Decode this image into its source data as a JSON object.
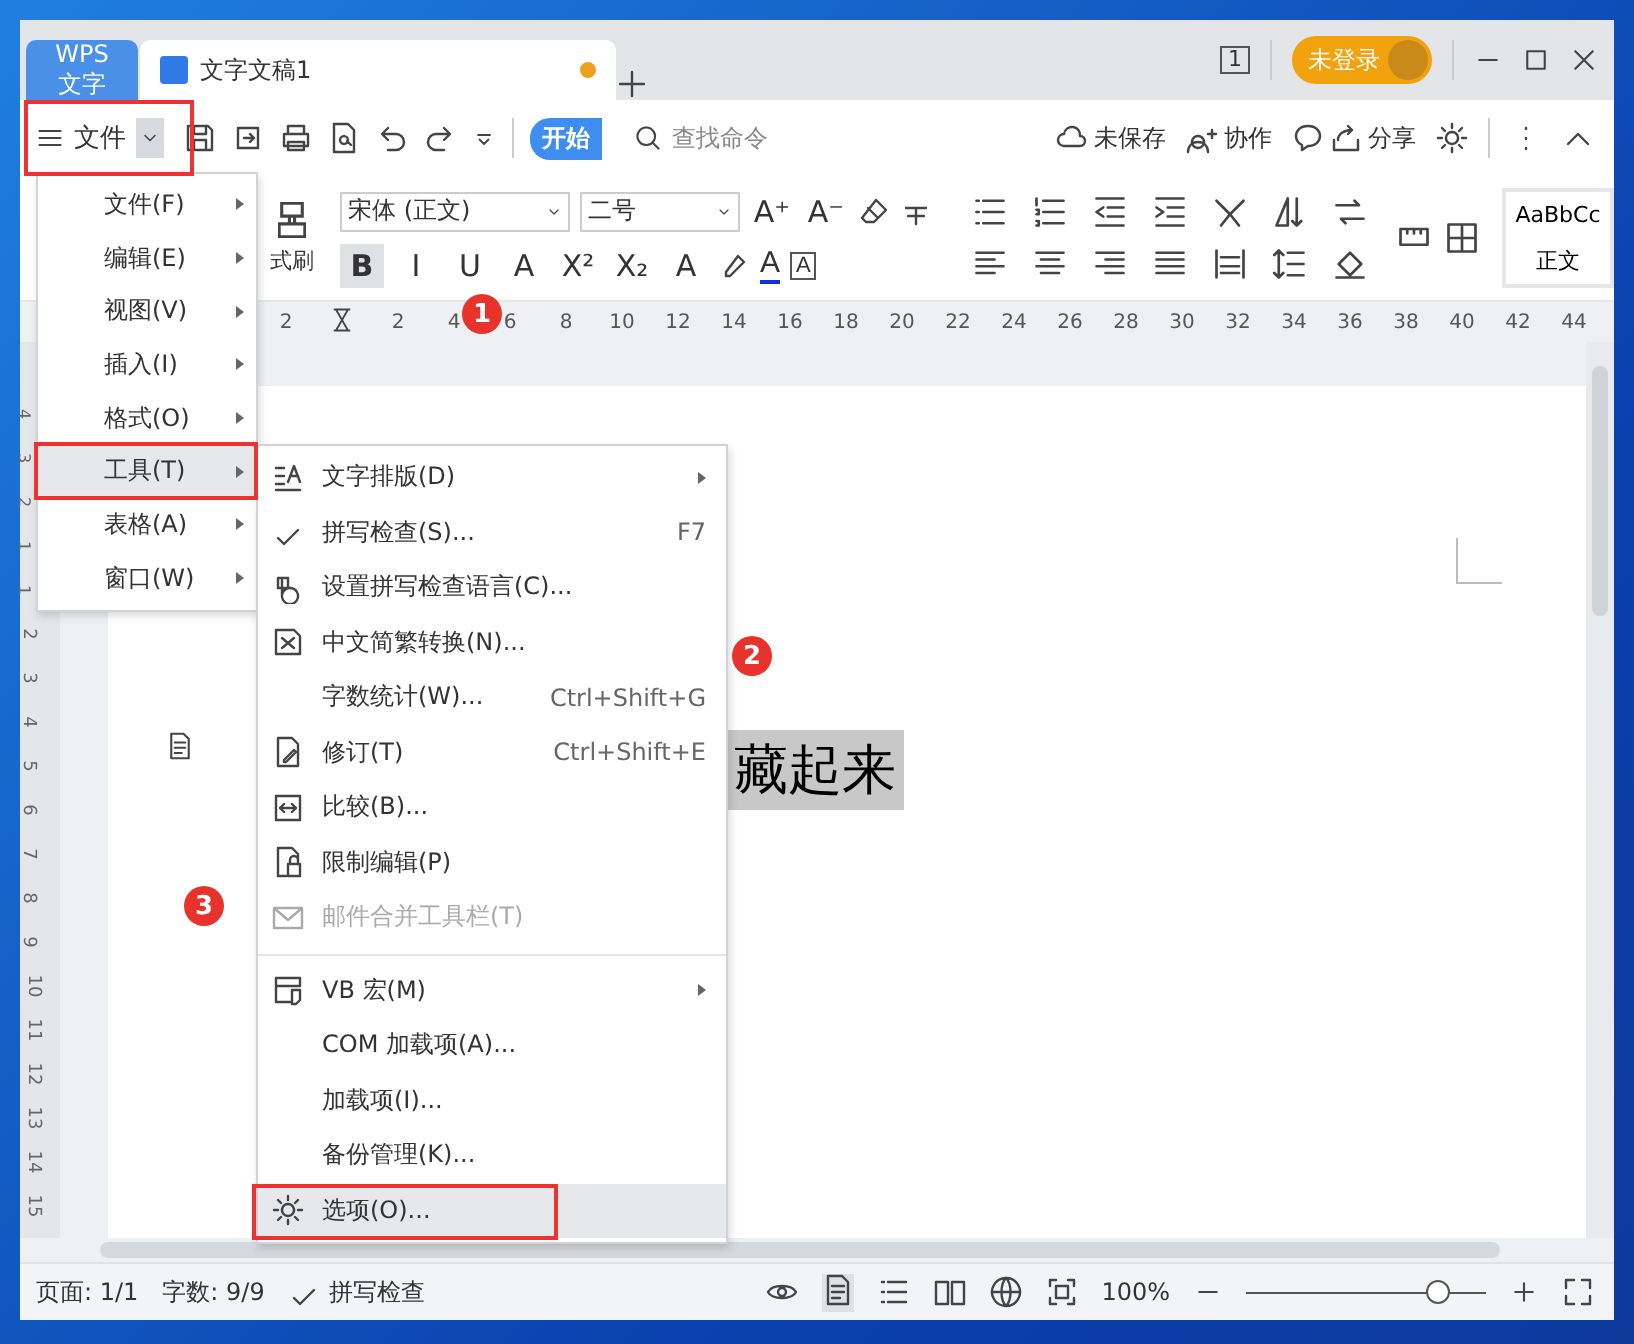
{
  "tabs": [
    {
      "label": "WPS 文字",
      "kind": "app",
      "selected": false
    },
    {
      "label": "文字文稿1",
      "kind": "doc",
      "selected": true,
      "unsaved": true
    }
  ],
  "title_bar": {
    "page_count": "1",
    "account": "未登录"
  },
  "quick_bar": {
    "menu_label": "文件",
    "ribbon_tab": "开始",
    "search_placeholder": "查找命令",
    "actions": [
      "未保存",
      "协作",
      "分享"
    ]
  },
  "ribbon": {
    "format_painter": "式刷",
    "font": "宋体 (正文)",
    "size": "二号",
    "format_buttons": [
      {
        "label": "B",
        "selected": true
      },
      {
        "label": "I",
        "selected": false
      },
      {
        "label": "U",
        "selected": false
      },
      {
        "label": "A",
        "selected": false
      },
      {
        "label": "X²",
        "selected": false
      },
      {
        "label": "X₂",
        "selected": false
      },
      {
        "label": "A",
        "selected": false
      }
    ],
    "font_color_label": "A",
    "border_label": "A",
    "grow_label": "A⁺",
    "shrink_label": "A⁻",
    "style_preview": "AaBbCc",
    "style_name": "正文"
  },
  "ruler": [
    "2",
    "2",
    "4",
    "6",
    "8",
    "10",
    "12",
    "14",
    "16",
    "18",
    "20",
    "22",
    "24",
    "26",
    "28",
    "30",
    "32",
    "34",
    "36",
    "38",
    "40",
    "42",
    "44"
  ],
  "left_ruler": [
    "4",
    "3",
    "2",
    "1",
    "1",
    "2",
    "3",
    "4",
    "5",
    "6",
    "7",
    "8",
    "9",
    "10",
    "11",
    "12",
    "13",
    "14",
    "15"
  ],
  "document": {
    "text": "藏起来"
  },
  "main_menu": [
    {
      "label": "文件(F)",
      "selected": false
    },
    {
      "label": "编辑(E)",
      "selected": false
    },
    {
      "label": "视图(V)",
      "selected": false
    },
    {
      "label": "插入(I)",
      "selected": false
    },
    {
      "label": "格式(O)",
      "selected": false
    },
    {
      "label": "工具(T)",
      "selected": true
    },
    {
      "label": "表格(A)",
      "selected": false
    },
    {
      "label": "窗口(W)",
      "selected": false
    }
  ],
  "tools_menu": [
    {
      "kind": "item",
      "label": "文字排版(D)",
      "submenu": true,
      "disabled": false,
      "selected": false
    },
    {
      "kind": "item",
      "label": "拼写检查(S)...",
      "shortcut": "F7",
      "submenu": false,
      "disabled": false,
      "selected": false
    },
    {
      "kind": "item",
      "label": "设置拼写检查语言(C)...",
      "submenu": false,
      "disabled": false,
      "selected": false
    },
    {
      "kind": "item",
      "label": "中文简繁转换(N)...",
      "submenu": false,
      "disabled": false,
      "selected": false
    },
    {
      "kind": "item",
      "label": "字数统计(W)...",
      "shortcut": "Ctrl+Shift+G",
      "submenu": false,
      "disabled": false,
      "selected": false
    },
    {
      "kind": "item",
      "label": "修订(T)",
      "shortcut": "Ctrl+Shift+E",
      "submenu": false,
      "disabled": false,
      "selected": false
    },
    {
      "kind": "item",
      "label": "比较(B)...",
      "submenu": false,
      "disabled": false,
      "selected": false
    },
    {
      "kind": "item",
      "label": "限制编辑(P)",
      "submenu": false,
      "disabled": false,
      "selected": false
    },
    {
      "kind": "item",
      "label": "邮件合并工具栏(T)",
      "submenu": false,
      "disabled": true,
      "selected": false
    },
    {
      "kind": "separator"
    },
    {
      "kind": "item",
      "label": "VB 宏(M)",
      "submenu": true,
      "disabled": false,
      "selected": false
    },
    {
      "kind": "item",
      "label": "COM 加载项(A)...",
      "submenu": false,
      "disabled": false,
      "selected": false
    },
    {
      "kind": "item",
      "label": "加载项(I)...",
      "submenu": false,
      "disabled": false,
      "selected": false
    },
    {
      "kind": "item",
      "label": "备份管理(K)...",
      "submenu": false,
      "disabled": false,
      "selected": false
    },
    {
      "kind": "item",
      "label": "选项(O)...",
      "submenu": false,
      "disabled": false,
      "selected": true
    }
  ],
  "annotations": [
    {
      "label": "1"
    },
    {
      "label": "2"
    },
    {
      "label": "3"
    }
  ],
  "status_bar": {
    "page": "页面: 1/1",
    "words": "字数: 9/9",
    "spell": "拼写检查",
    "zoom": "100%",
    "level": 0.8
  }
}
